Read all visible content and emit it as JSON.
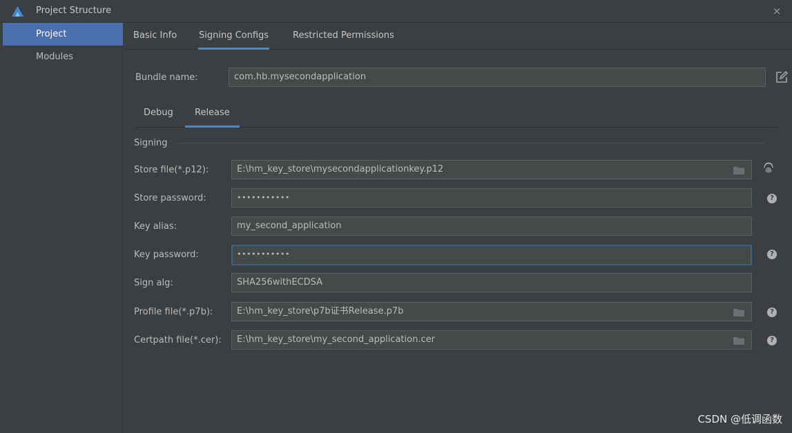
{
  "window": {
    "title": "Project Structure",
    "close_label": "×"
  },
  "sidebar": {
    "items": [
      {
        "label": "Project",
        "active": true
      },
      {
        "label": "Modules",
        "active": false
      }
    ]
  },
  "tabs": [
    {
      "label": "Basic Info"
    },
    {
      "label": "Signing Configs",
      "active": true
    },
    {
      "label": "Restricted Permissions"
    }
  ],
  "bundle": {
    "label": "Bundle name:",
    "value": "com.hb.mysecondapplication"
  },
  "subtabs": [
    {
      "label": "Debug"
    },
    {
      "label": "Release",
      "active": true
    }
  ],
  "section": {
    "title": "Signing"
  },
  "form": {
    "store_file": {
      "label": "Store file(*.p12):",
      "value": "E:\\hm_key_store\\mysecondapplicationkey.p12"
    },
    "store_password": {
      "label": "Store password:",
      "value": "•••••••••••"
    },
    "key_alias": {
      "label": "Key alias:",
      "value": "my_second_application"
    },
    "key_password": {
      "label": "Key password:",
      "value": "•••••••••••"
    },
    "sign_alg": {
      "label": "Sign alg:",
      "value": "SHA256withECDSA"
    },
    "profile_file": {
      "label": "Profile file(*.p7b):",
      "value": "E:\\hm_key_store\\p7b证书Release.p7b"
    },
    "certpath_file": {
      "label": "Certpath file(*.cer):",
      "value": "E:\\hm_key_store\\my_second_application.cer"
    }
  },
  "help_glyph": "?",
  "watermark": "CSDN @低调函数",
  "colors": {
    "accent": "#4a88c7",
    "selection": "#4b6eaf",
    "background": "#3c3f41",
    "field": "#45494a"
  },
  "icons": [
    "app-logo-icon",
    "close-icon",
    "edit-icon",
    "folder-icon",
    "fingerprint-icon",
    "help-icon"
  ]
}
